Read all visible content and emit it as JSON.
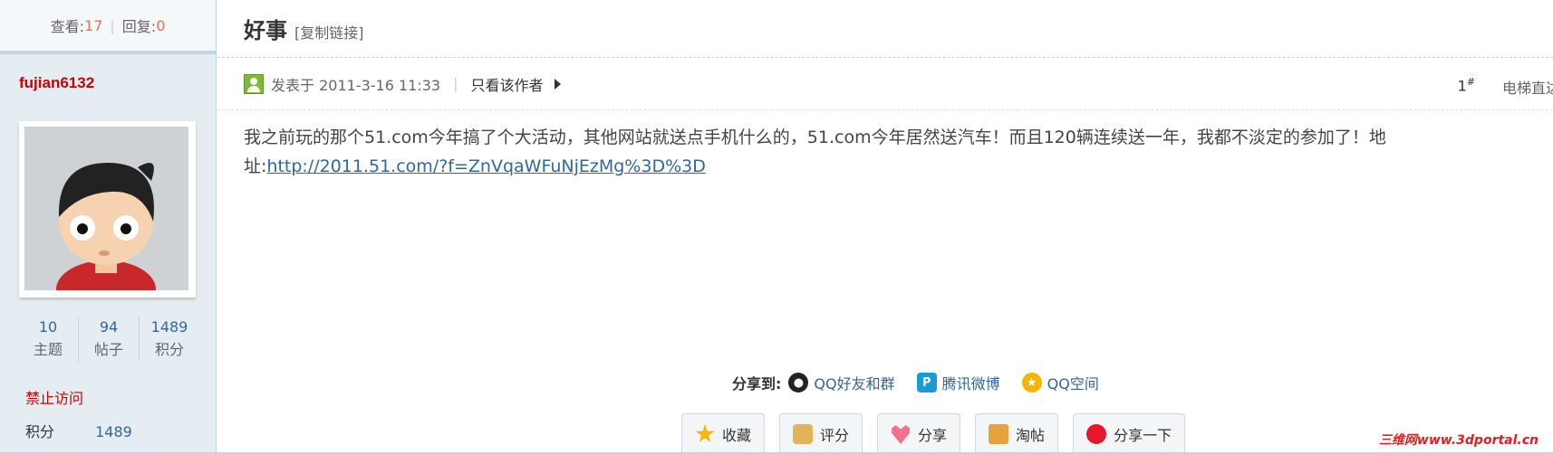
{
  "stats_top": {
    "views_label": "查看:",
    "views": "17",
    "replies_label": "回复:",
    "replies": "0"
  },
  "author": {
    "name": "fujian6132"
  },
  "profile": {
    "stats": [
      {
        "value": "10",
        "label": "主题"
      },
      {
        "value": "94",
        "label": "帖子"
      },
      {
        "value": "1489",
        "label": "积分"
      }
    ],
    "status": "禁止访问",
    "score_label": "积分",
    "score_value": "1489"
  },
  "thread": {
    "title": "好事",
    "copy_link": "[复制链接]"
  },
  "post": {
    "posted_at": "发表于 2011-3-16 11:33",
    "only_author": "只看该作者",
    "floor": "1",
    "floor_mark": "#",
    "elevator": "电梯直达",
    "body": "我之前玩的那个51.com今年搞了个大活动，其他网站就送点手机什么的，51.com今年居然送汽车！而且120辆连续送一年，我都不淡定的参加了！地址:",
    "link": "http://2011.51.com/?f=ZnVqaWFuNjEzMg%3D%3D"
  },
  "share": {
    "label": "分享到:",
    "items": [
      "QQ好友和群",
      "腾讯微博",
      "QQ空间"
    ]
  },
  "actions": [
    "收藏",
    "评分",
    "分享",
    "淘帖",
    "分享一下"
  ],
  "watermark": "三维网www.3dportal.cn"
}
